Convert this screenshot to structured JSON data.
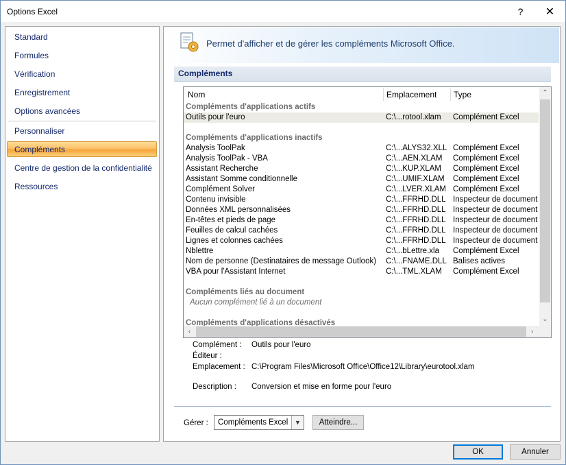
{
  "window": {
    "title": "Options Excel",
    "help": "?",
    "close": "✕"
  },
  "nav": {
    "items": [
      "Standard",
      "Formules",
      "Vérification",
      "Enregistrement",
      "Options avancées",
      "Personnaliser",
      "Compléments",
      "Centre de gestion de la confidentialité",
      "Ressources"
    ],
    "selected": "Compléments"
  },
  "banner": {
    "text": "Permet d'afficher et de gérer les compléments Microsoft Office."
  },
  "section": {
    "title": "Compléments"
  },
  "list": {
    "columns": [
      "Nom",
      "Emplacement",
      "Type"
    ],
    "groups": {
      "active": "Compléments d'applications actifs",
      "inactive": "Compléments d'applications inactifs",
      "document": "Compléments liés au document",
      "document_empty": "Aucun complément lié à un document",
      "disabled": "Compléments d'applications désactivés"
    },
    "active_rows": [
      [
        "Outils pour l'euro",
        "C:\\...rotool.xlam",
        "Complément Excel"
      ]
    ],
    "inactive_rows": [
      [
        "Analysis ToolPak",
        "C:\\...ALYS32.XLL",
        "Complément Excel"
      ],
      [
        "Analysis ToolPak - VBA",
        "C:\\...AEN.XLAM",
        "Complément Excel"
      ],
      [
        "Assistant Recherche",
        "C:\\...KUP.XLAM",
        "Complément Excel"
      ],
      [
        "Assistant Somme conditionnelle",
        "C:\\...UMIF.XLAM",
        "Complément Excel"
      ],
      [
        "Complément Solver",
        "C:\\...LVER.XLAM",
        "Complément Excel"
      ],
      [
        "Contenu invisible",
        "C:\\...FFRHD.DLL",
        "Inspecteur de document"
      ],
      [
        "Données XML personnalisées",
        "C:\\...FFRHD.DLL",
        "Inspecteur de document"
      ],
      [
        "En-têtes et pieds de page",
        "C:\\...FFRHD.DLL",
        "Inspecteur de document"
      ],
      [
        "Feuilles de calcul cachées",
        "C:\\...FFRHD.DLL",
        "Inspecteur de document"
      ],
      [
        "Lignes et colonnes cachées",
        "C:\\...FFRHD.DLL",
        "Inspecteur de document"
      ],
      [
        "Nblettre",
        "C:\\...bLettre.xla",
        "Complément Excel"
      ],
      [
        "Nom de personne (Destinataires de message Outlook)",
        "C:\\...FNAME.DLL",
        "Balises actives"
      ],
      [
        "VBA pour l'Assistant Internet",
        "C:\\...TML.XLAM",
        "Complément Excel"
      ]
    ]
  },
  "details": {
    "complement_label": "Complément :",
    "complement_value": "Outils pour l'euro",
    "editeur_label": "Éditeur :",
    "editeur_value": "",
    "emplacement_label": "Emplacement :",
    "emplacement_value": "C:\\Program Files\\Microsoft Office\\Office12\\Library\\eurotool.xlam",
    "description_label": "Description :",
    "description_value": "Conversion et mise en forme pour l'euro"
  },
  "manage": {
    "label": "Gérer :",
    "selected": "Compléments Excel",
    "go_button": "Atteindre..."
  },
  "footer": {
    "ok": "OK",
    "cancel": "Annuler"
  },
  "colors": {
    "accent": "#0078d7",
    "nav_text": "#14296c",
    "selected_nav": "#f7a33a"
  },
  "icons": [
    "addins-gear-icon",
    "chevron-down-icon",
    "scroll-up-icon",
    "scroll-down-icon",
    "scroll-left-icon",
    "scroll-right-icon"
  ]
}
